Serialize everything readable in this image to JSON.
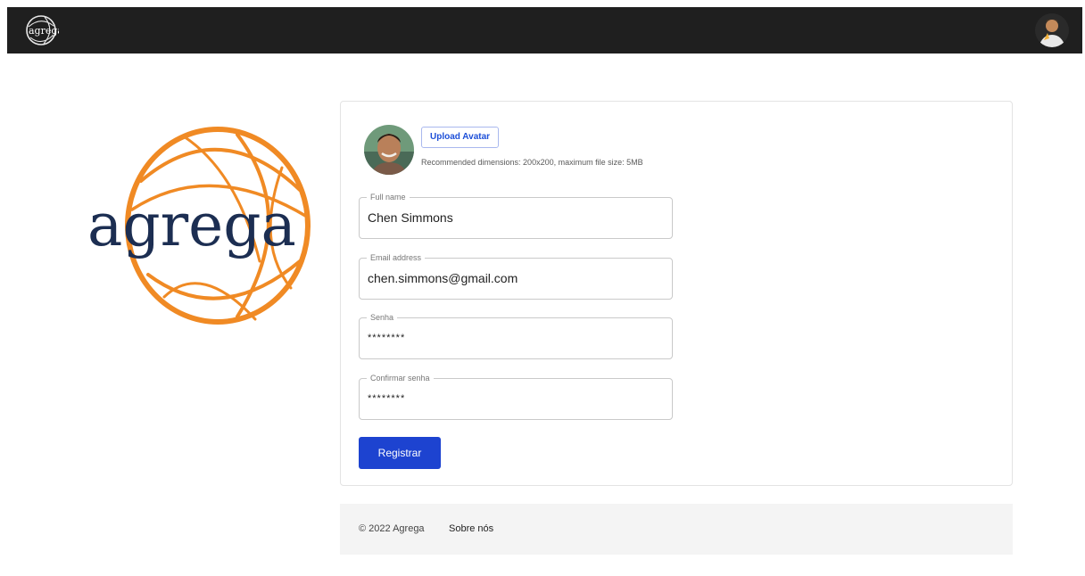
{
  "brand": {
    "logo_text": "agrega",
    "accent_orange": "#f08a24",
    "logo_navy": "#1c2e52"
  },
  "header": {
    "logo_icon": "agrega-logo-icon",
    "avatar_icon": "user-avatar-icon"
  },
  "profile": {
    "upload_label": "Upload Avatar",
    "hint": "Recommended dimensions: 200x200, maximum file size: 5MB"
  },
  "form": {
    "full_name": {
      "label": "Full name",
      "value": "Chen Simmons"
    },
    "email": {
      "label": "Email address",
      "value": "chen.simmons@gmail.com"
    },
    "password": {
      "label": "Senha",
      "value": "********"
    },
    "confirm_password": {
      "label": "Confirmar senha",
      "value": "********"
    },
    "submit_label": "Registrar",
    "primary_color": "#1d43d0"
  },
  "footer": {
    "copyright": "© 2022 Agrega",
    "about_link": "Sobre nós"
  }
}
